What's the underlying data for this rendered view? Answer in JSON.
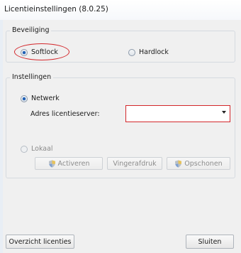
{
  "window": {
    "title": "Licentieinstellingen (8.0.25)"
  },
  "beveiliging": {
    "legend": "Beveiliging",
    "options": [
      {
        "label": "Softlock",
        "selected": true
      },
      {
        "label": "Hardlock",
        "selected": false
      }
    ]
  },
  "instellingen": {
    "legend": "Instellingen",
    "netwerk": {
      "label": "Netwerk",
      "selected": true
    },
    "server": {
      "label": "Adres licentieserver:",
      "value": ""
    },
    "lokaal": {
      "label": "Lokaal",
      "selected": false
    },
    "buttons": {
      "activeren": "Activeren",
      "vingerafdruk": "Vingerafdruk",
      "opschonen": "Opschonen"
    }
  },
  "footer": {
    "overzicht": "Overzicht licenties",
    "sluiten": "Sluiten"
  },
  "colors": {
    "highlight": "#d3272b",
    "radio_selected": "#1e5fb4"
  },
  "icons": {
    "shield": "uac-shield-icon"
  }
}
